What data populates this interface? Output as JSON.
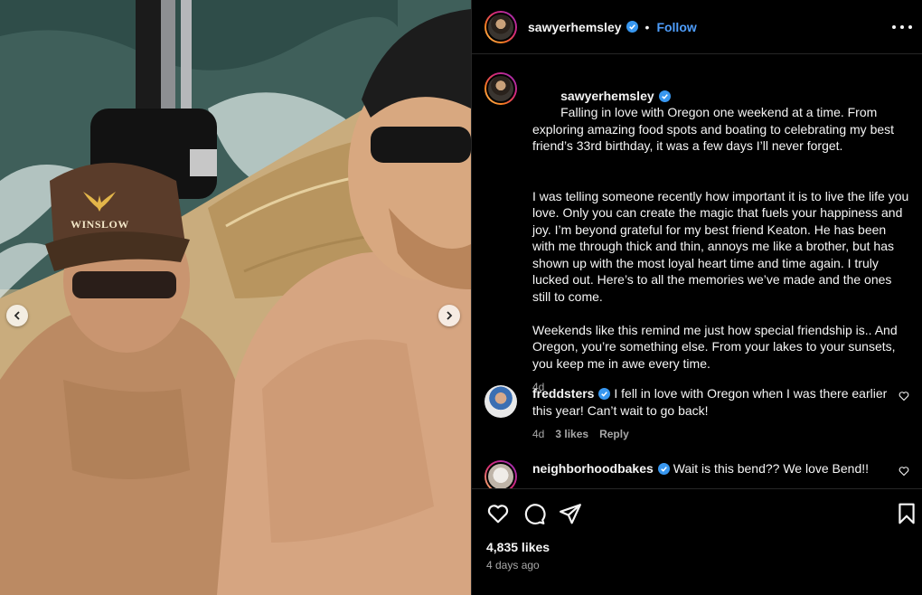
{
  "post": {
    "username": "sawyerhemsley",
    "follow_label": "Follow",
    "separator": "•",
    "caption_paragraphs": [
      "Falling in love with Oregon one weekend at a time. From exploring amazing food spots and boating to celebrating my best friend’s 33rd birthday, it was a few days I’ll never forget.",
      "I was telling someone recently how important it is to live the life you love. Only you can create the magic that fuels your happiness and joy. I’m beyond grateful for my best friend Keaton. He has been with me through thick and thin, annoys me like a brother, but has shown up with the most loyal heart time and time again. I truly lucked out. Here’s to all the memories we’ve made and the ones still to come.",
      "Weekends like this remind me just how special friendship is.. And Oregon, you’re something else. From your lakes to your sunsets, you keep me in awe every time."
    ],
    "caption_time": "4d",
    "likes": "4,835 likes",
    "posted_ago": "4 days ago",
    "photo_cap_text": "WINSLOW"
  },
  "comments": [
    {
      "username": "freddsters",
      "text": "I fell in love with Oregon when I was there earlier this year! Can’t wait to go back!",
      "time": "4d",
      "likes": "3 likes",
      "reply_label": "Reply"
    },
    {
      "username": "neighborhoodbakes",
      "text": "Wait is this bend?? We love Bend!!"
    }
  ],
  "icons": {
    "verified": "verified-badge-icon",
    "more": "more-options-icon",
    "like": "heart-icon",
    "comment": "comment-bubble-icon",
    "share": "paper-plane-icon",
    "save": "bookmark-icon",
    "prev": "chevron-left-icon",
    "next": "chevron-right-icon"
  },
  "colors": {
    "background": "#000000",
    "text": "#f5f5f5",
    "secondary_text": "#a8a8a8",
    "link_blue": "#4e9dfb",
    "verified_blue": "#3897f0",
    "divider": "#262626"
  }
}
